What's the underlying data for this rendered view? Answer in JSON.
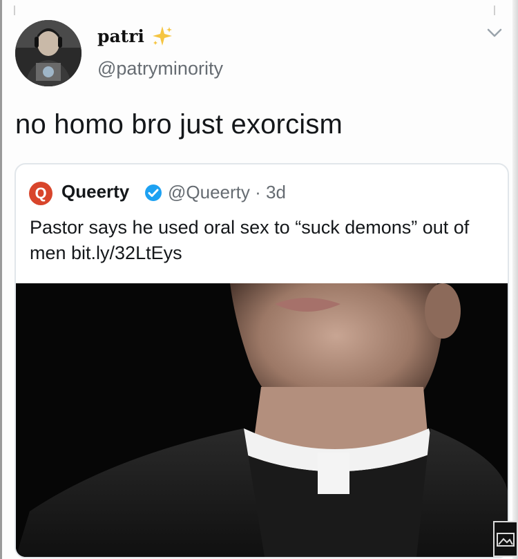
{
  "author": {
    "display_name": "patri",
    "handle": "@patryminority"
  },
  "tweet": {
    "text": "no homo bro just exorcism"
  },
  "quoted_tweet": {
    "logo_letter": "Q",
    "name": "Queerty",
    "meta": "@Queerty · 3d",
    "text": "Pastor says he used oral sex to “suck demons” out of men bit.ly/32LtEys"
  },
  "icons": {
    "sparkle": "sparkle-icon",
    "verified": "verified-badge-icon",
    "chevron": "chevron-down-icon",
    "image": "image-icon"
  },
  "colors": {
    "sparkle": "#f5c542",
    "verified": "#1da1f2",
    "queerty_logo": "#d8452b",
    "secondary_text": "#666c72"
  }
}
